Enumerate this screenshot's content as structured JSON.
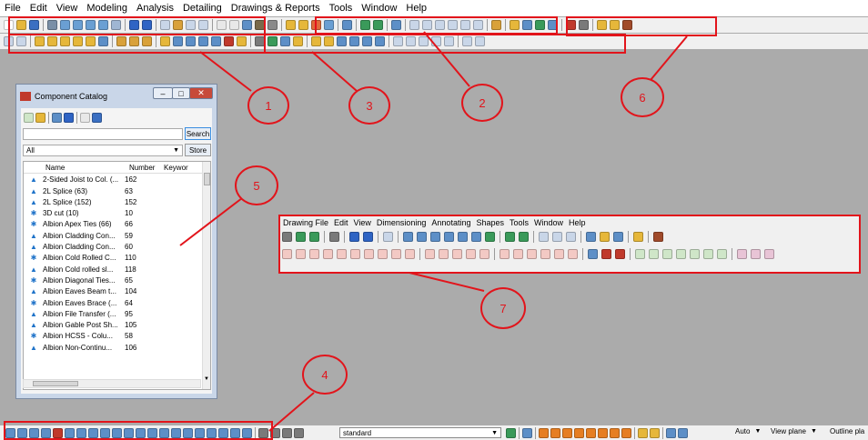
{
  "menu": [
    "File",
    "Edit",
    "View",
    "Modeling",
    "Analysis",
    "Detailing",
    "Drawings & Reports",
    "Tools",
    "Window",
    "Help"
  ],
  "catalog": {
    "title": "Component Catalog",
    "search_value": "",
    "search_button": "Search",
    "filter_value": "All",
    "store_button": "Store",
    "columns": [
      "Name",
      "Number",
      "Keywor"
    ],
    "rows": [
      {
        "name": "2-Sided Joist to Col. (...",
        "number": "162"
      },
      {
        "name": "2L Splice (63)",
        "number": "63"
      },
      {
        "name": "2L Splice (152)",
        "number": "152"
      },
      {
        "name": "3D cut (10)",
        "number": "10"
      },
      {
        "name": "Albion Apex Ties (66)",
        "number": "66"
      },
      {
        "name": "Albion Cladding Con...",
        "number": "59"
      },
      {
        "name": "Albion Cladding Con...",
        "number": "60"
      },
      {
        "name": "Albion Cold Rolled C...",
        "number": "110"
      },
      {
        "name": "Albion Cold rolled sl...",
        "number": "118"
      },
      {
        "name": "Albion Diagonal Ties...",
        "number": "65"
      },
      {
        "name": "Albion Eaves Beam t...",
        "number": "104"
      },
      {
        "name": "Albion Eaves Brace (...",
        "number": "64"
      },
      {
        "name": "Albion File Transfer (...",
        "number": "95"
      },
      {
        "name": "Albion Gable Post Sh...",
        "number": "105"
      },
      {
        "name": "Albion HCSS - Colu...",
        "number": "58"
      },
      {
        "name": "Albion Non-Continu...",
        "number": "106"
      }
    ]
  },
  "drawing_menu": [
    "Drawing File",
    "Edit",
    "View",
    "Dimensioning",
    "Annotating",
    "Shapes",
    "Tools",
    "Window",
    "Help"
  ],
  "bottom": {
    "standard": "standard",
    "auto": "Auto",
    "view_plane": "View plane",
    "outline": "Outline pla"
  },
  "callouts": [
    "1",
    "2",
    "3",
    "4",
    "5",
    "6",
    "7"
  ],
  "colors": {
    "annotation": "#e2141b",
    "background": "#ababab",
    "window": "#c9d6e8"
  }
}
